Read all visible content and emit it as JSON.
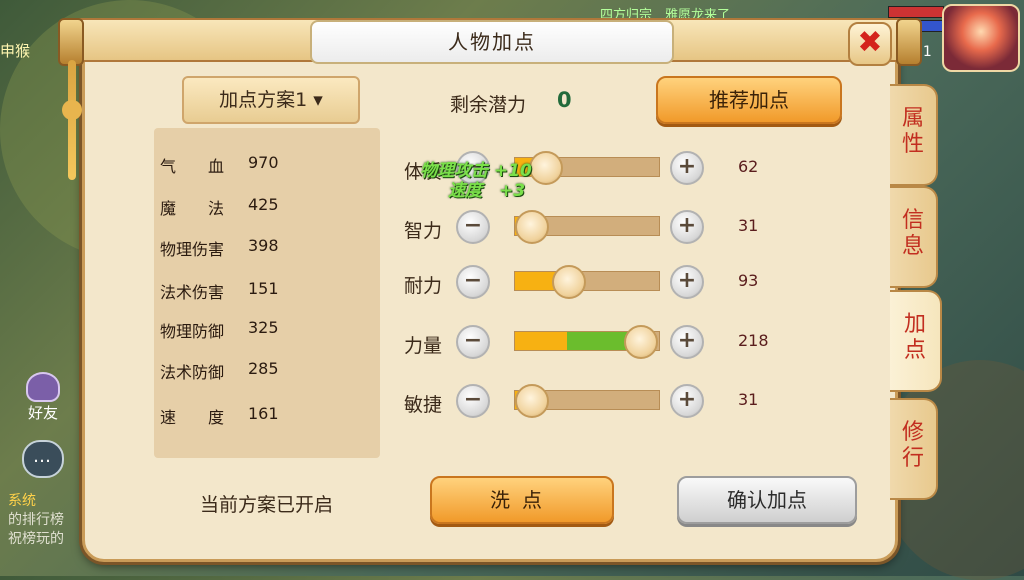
{
  "window": {
    "title": "人物加点",
    "close_symbol": "✖"
  },
  "scheme": {
    "label": "加点方案1 ▾"
  },
  "potential": {
    "label": "剩余潜力",
    "value": "0"
  },
  "buttons": {
    "recommend": "推荐加点",
    "wash": "洗点",
    "confirm": "确认加点"
  },
  "stats": [
    {
      "name": "气　　血",
      "value": "970"
    },
    {
      "name": "魔　　法",
      "value": "425"
    },
    {
      "name": "物理伤害",
      "value": "398"
    },
    {
      "name": "法术伤害",
      "value": "151"
    },
    {
      "name": "物理防御",
      "value": "325"
    },
    {
      "name": "法术防御",
      "value": "285"
    },
    {
      "name": "速　　度",
      "value": "161"
    }
  ],
  "attributes": [
    {
      "name": "体质",
      "value": "62",
      "base_fraction": 0.2,
      "add_fraction": 0.0
    },
    {
      "name": "智力",
      "value": "31",
      "base_fraction": 0.1,
      "add_fraction": 0.0
    },
    {
      "name": "耐力",
      "value": "93",
      "base_fraction": 0.36,
      "add_fraction": 0.0
    },
    {
      "name": "力量",
      "value": "218",
      "base_fraction": 0.36,
      "add_fraction": 0.5
    },
    {
      "name": "敏捷",
      "value": "31",
      "base_fraction": 0.1,
      "add_fraction": 0.0
    }
  ],
  "float_hint": {
    "line1": "物理攻击 +10",
    "line2": "速度　+3"
  },
  "status_text": "当前方案已开启",
  "side_tabs": [
    {
      "label": "属性",
      "active": false
    },
    {
      "label": "信息",
      "active": false
    },
    {
      "label": "加点",
      "active": true
    },
    {
      "label": "修行",
      "active": false
    }
  ],
  "background": {
    "top_left_text": "申猴",
    "friend_label": "好友",
    "system_lines": [
      "系统",
      "的排行榜",
      "祝榜玩的"
    ],
    "top_right_text": "四方归宗　雅愿龙来了",
    "level": "31"
  },
  "colors": {
    "accent": "#f19a2a",
    "tab_text": "#c22e20",
    "potential": "#226b3b",
    "bar_base": "#f7b112",
    "bar_add": "#6bbd2d"
  }
}
